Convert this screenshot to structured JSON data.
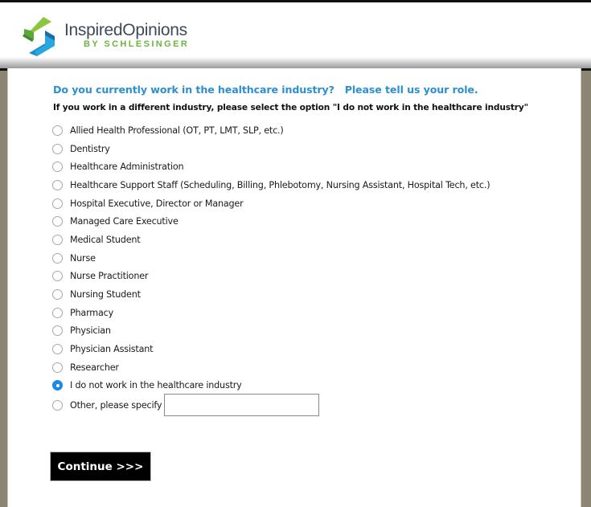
{
  "brand": {
    "name": "InspiredOpinions",
    "subtitle": "BY SCHLESINGER",
    "colors": {
      "green_light": "#8cc63f",
      "green_dark": "#4f9a36",
      "blue_dark": "#1b6fa8",
      "blue_light": "#29a8e0"
    }
  },
  "survey": {
    "question": "Do you currently work in the healthcare industry?   Please tell us your role.",
    "instruction": "If you work in a different industry, please select the option \"I do not work in the healthcare industry\"",
    "options": [
      {
        "label": "Allied Health Professional (OT, PT, LMT, SLP, etc.)",
        "selected": false
      },
      {
        "label": "Dentistry",
        "selected": false
      },
      {
        "label": "Healthcare Administration",
        "selected": false
      },
      {
        "label": "Healthcare Support Staff (Scheduling, Billing, Phlebotomy, Nursing Assistant, Hospital Tech, etc.)",
        "selected": false
      },
      {
        "label": "Hospital Executive, Director or Manager",
        "selected": false
      },
      {
        "label": "Managed Care Executive",
        "selected": false
      },
      {
        "label": "Medical Student",
        "selected": false
      },
      {
        "label": "Nurse",
        "selected": false
      },
      {
        "label": "Nurse Practitioner",
        "selected": false
      },
      {
        "label": "Nursing Student",
        "selected": false
      },
      {
        "label": "Pharmacy",
        "selected": false
      },
      {
        "label": "Physician",
        "selected": false
      },
      {
        "label": "Physician Assistant",
        "selected": false
      },
      {
        "label": "Researcher",
        "selected": false
      },
      {
        "label": "I do not work in the healthcare industry",
        "selected": true
      },
      {
        "label": "Other, please specify",
        "selected": false,
        "has_input": true
      }
    ],
    "other_input_value": "",
    "selected_value": "I do not work in the healthcare industry",
    "accent_color": "#2c8fd0"
  },
  "actions": {
    "continue_label": "Continue >>>"
  }
}
